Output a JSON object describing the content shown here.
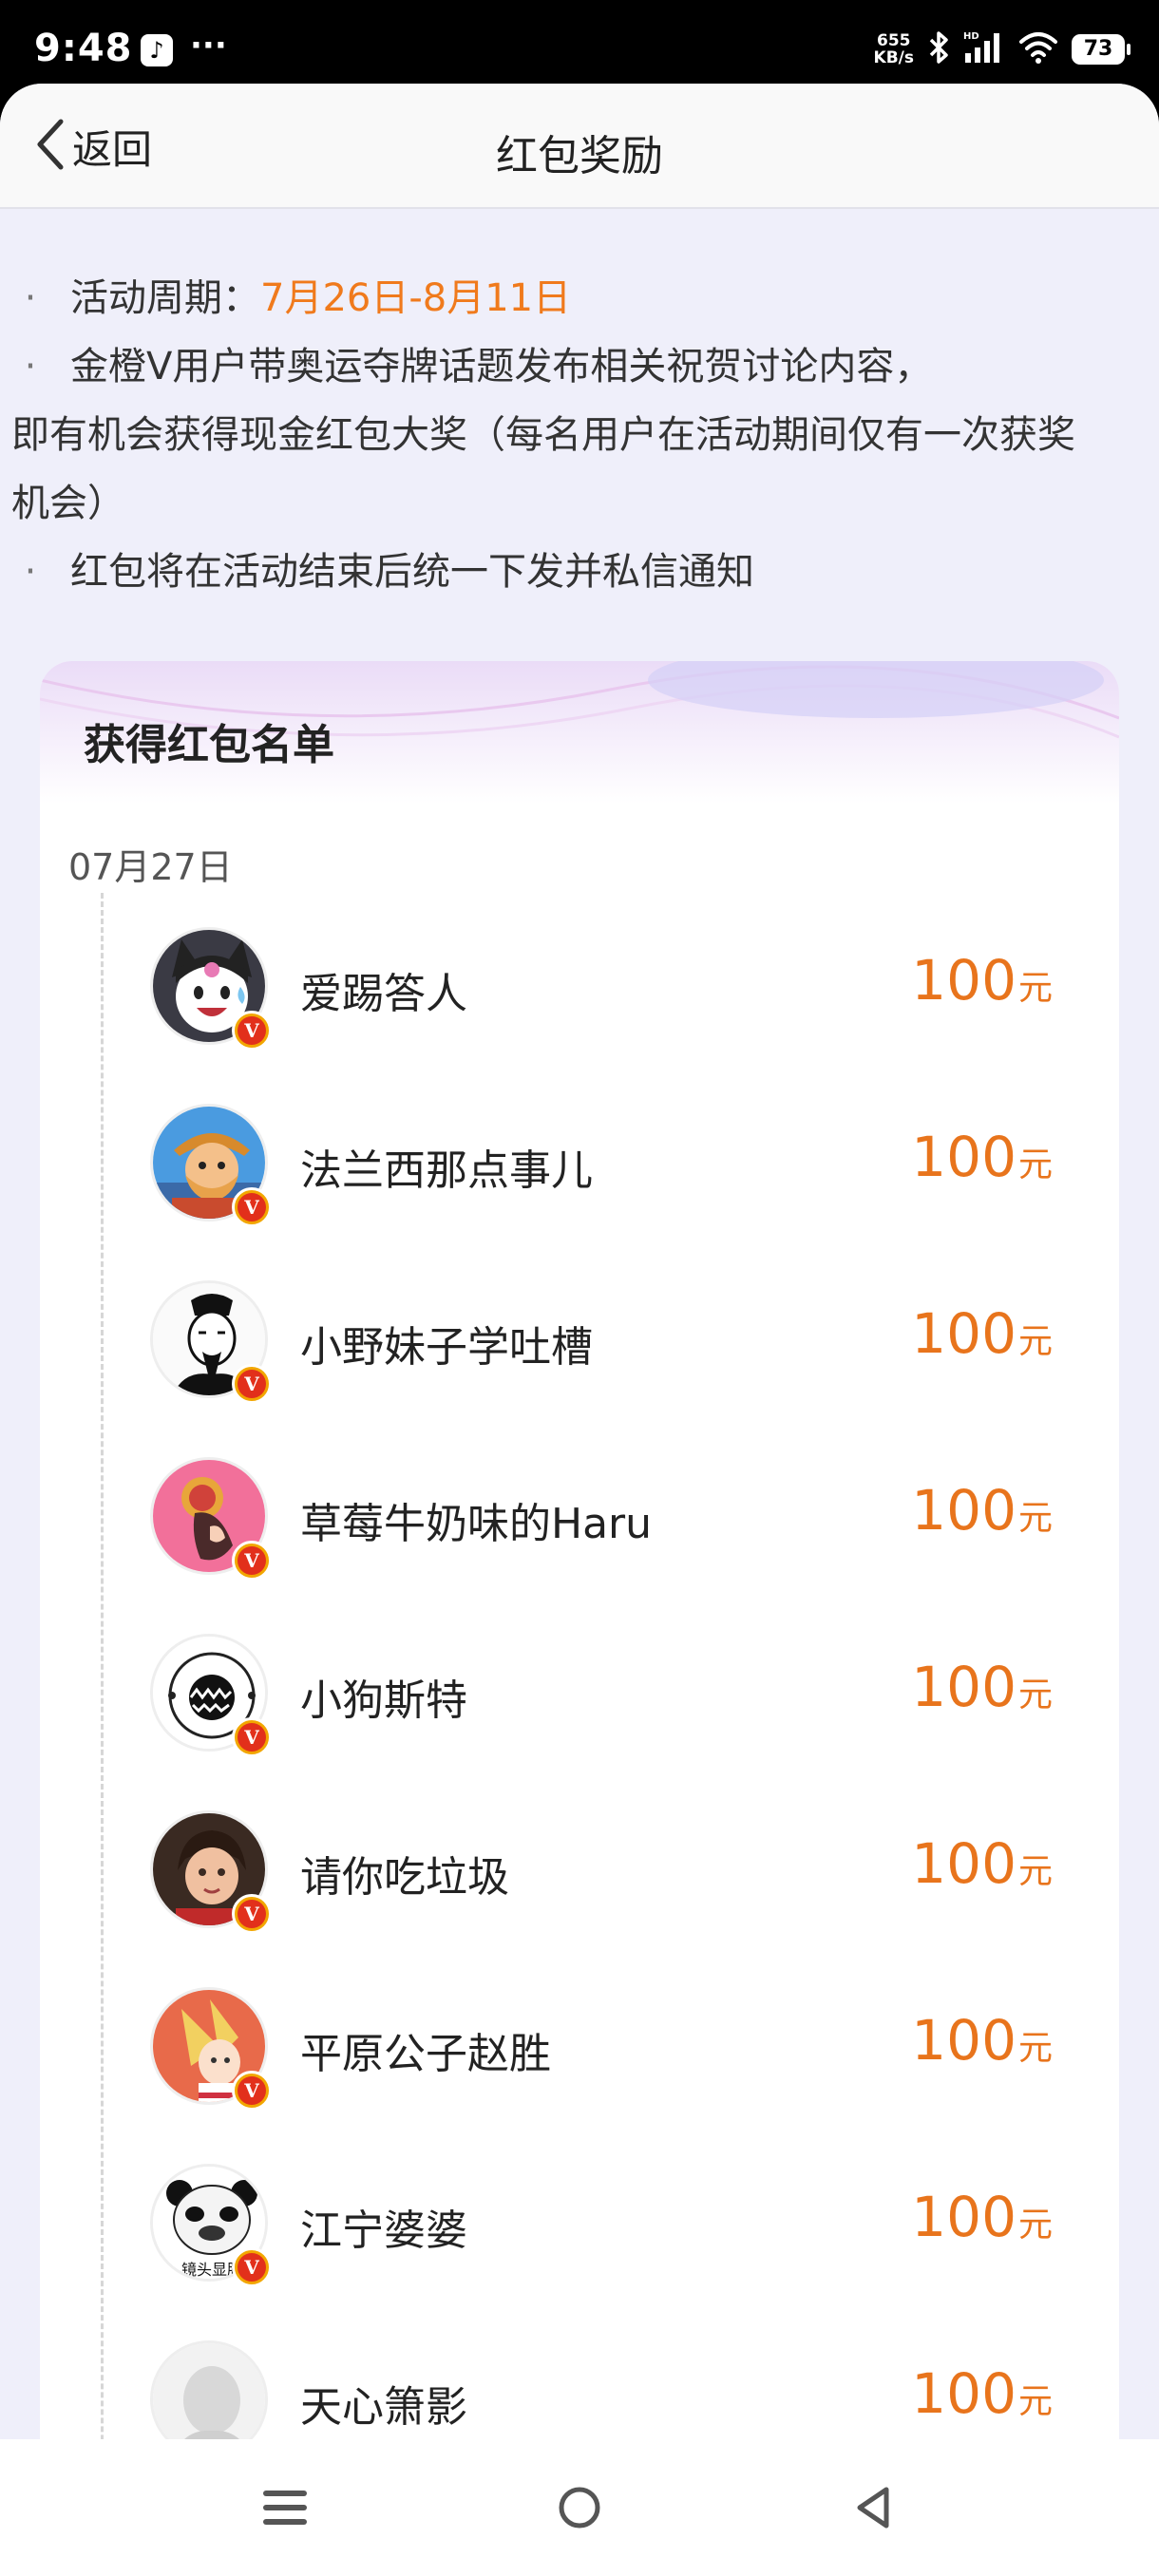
{
  "status_bar": {
    "time": "9:48",
    "app_icon": "tiktok-icon",
    "more": "···",
    "net_speed_value": "655",
    "net_speed_unit": "KB/s",
    "battery": "73"
  },
  "header": {
    "back_label": "返回",
    "title": "红包奖励"
  },
  "rules": {
    "bullet": "·",
    "period_label": "活动周期：",
    "period_value": "7月26日-8月11日",
    "rule2_first": "金橙V用户带奥运夺牌话题发布相关祝贺讨论内容，",
    "rule2_rest": "即有机会获得现金红包大奖（每名用户在活动期间仅有一次获奖机会）",
    "rule3": "红包将在活动结束后统一下发并私信通知"
  },
  "card": {
    "title": "获得红包名单",
    "date": "07月27日"
  },
  "winners": [
    {
      "name": "爱踢答人",
      "amount": "100",
      "unit": "元",
      "avatar": "kuromi-avatar"
    },
    {
      "name": "法兰西那点事儿",
      "amount": "100",
      "unit": "元",
      "avatar": "cartoon-pirate-avatar"
    },
    {
      "name": "小野妹子学吐槽",
      "amount": "100",
      "unit": "元",
      "avatar": "ink-portrait-avatar"
    },
    {
      "name": "草莓牛奶味的Haru",
      "amount": "100",
      "unit": "元",
      "avatar": "pink-girl-avatar"
    },
    {
      "name": "小狗斯特",
      "amount": "100",
      "unit": "元",
      "avatar": "white-monster-avatar"
    },
    {
      "name": "请你吃垃圾",
      "amount": "100",
      "unit": "元",
      "avatar": "child-photo-avatar"
    },
    {
      "name": "平原公子赵胜",
      "amount": "100",
      "unit": "元",
      "avatar": "anime-girl-avatar"
    },
    {
      "name": "江宁婆婆",
      "amount": "100",
      "unit": "元",
      "avatar": "panda-meme-avatar",
      "avatar_caption": "镜头显胖"
    },
    {
      "name": "天心箫影",
      "amount": "100",
      "unit": "元",
      "avatar": "statue-avatar"
    }
  ],
  "nav": {
    "menu": "menu-icon",
    "home": "home-circle-icon",
    "back": "back-triangle-icon"
  },
  "colors": {
    "accent_orange": "#f07a1c",
    "amount_orange": "#e8741c",
    "page_bg": "#efeffa"
  }
}
